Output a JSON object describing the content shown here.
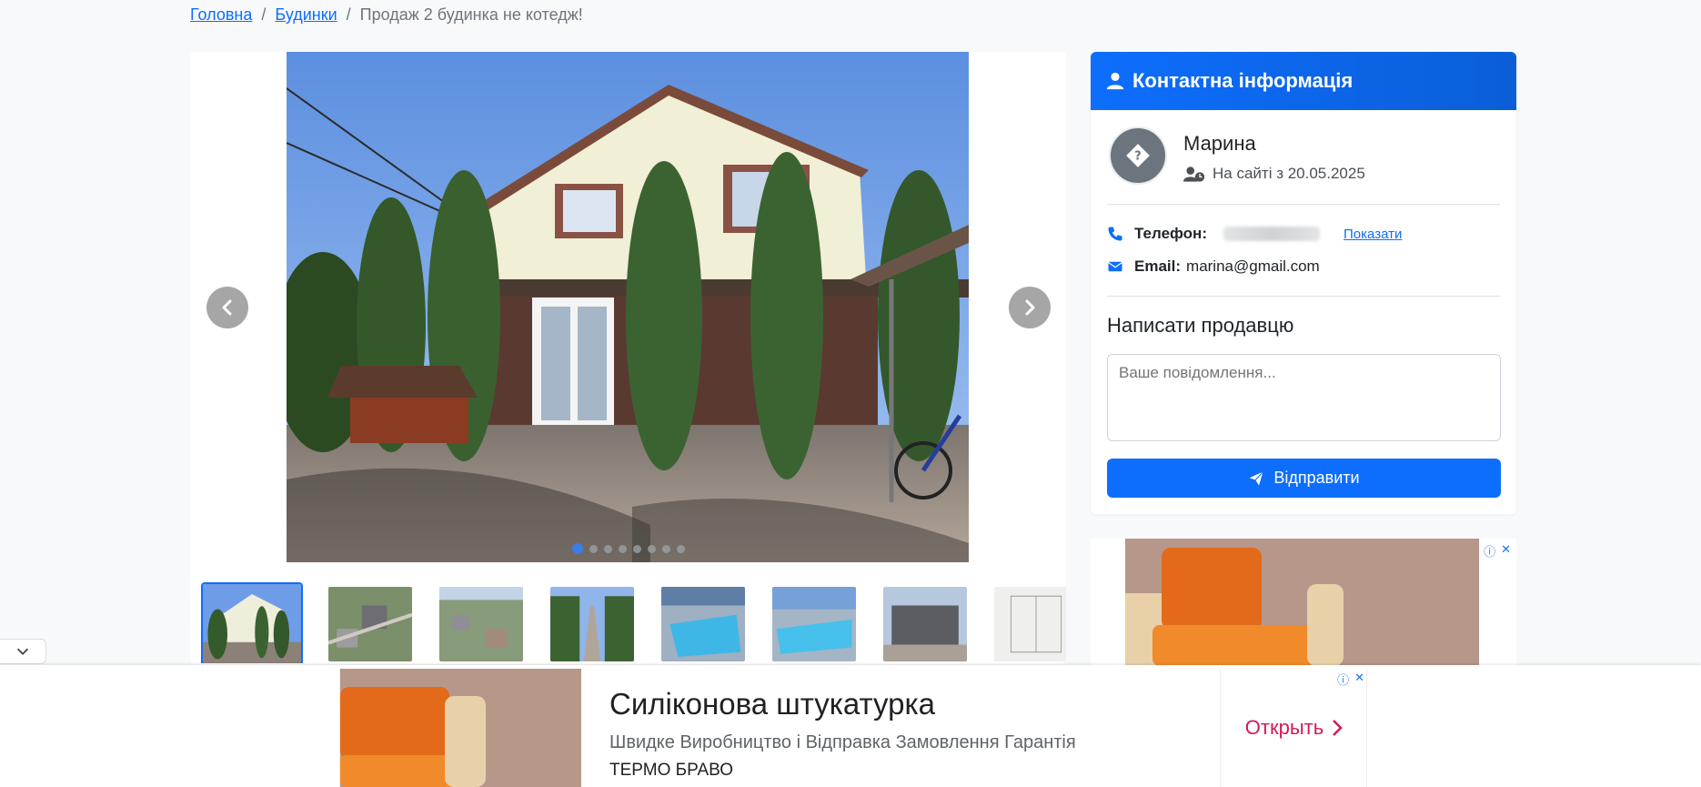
{
  "breadcrumb": {
    "home": "Головна",
    "category": "Будинки",
    "current": "Продаж 2 будинка не котедж!",
    "separator": "/"
  },
  "gallery": {
    "photo_count": 8,
    "active_index": 0,
    "thumbnails": [
      "house-front",
      "aerial-1",
      "aerial-2",
      "hedge-path",
      "pool-1",
      "pool-2",
      "annex",
      "floor-plan"
    ]
  },
  "contact": {
    "header": "Контактна інформація",
    "seller_name": "Марина",
    "since_text": "На сайті з 20.05.2025",
    "phone_label": "Телефон:",
    "show_label": "Показати",
    "email_label": "Email:",
    "email": "marina@gmail.com",
    "write_title": "Написати продавцю",
    "message_placeholder": "Ваше повідомлення...",
    "send_label": "Відправити"
  },
  "bottom_ad": {
    "title": "Силіконова штукатурка",
    "description": "Швидке Виробництво і Відправка Замовлення Гарантія",
    "brand": "ТЕРМО БРАВО",
    "open_label": "Открыть",
    "info": "ⓘ",
    "close": "✕"
  },
  "side_ad": {
    "info": "ⓘ",
    "close": "✕"
  },
  "colors": {
    "primary": "#0d6efd",
    "ad_accent": "#d2185c"
  }
}
